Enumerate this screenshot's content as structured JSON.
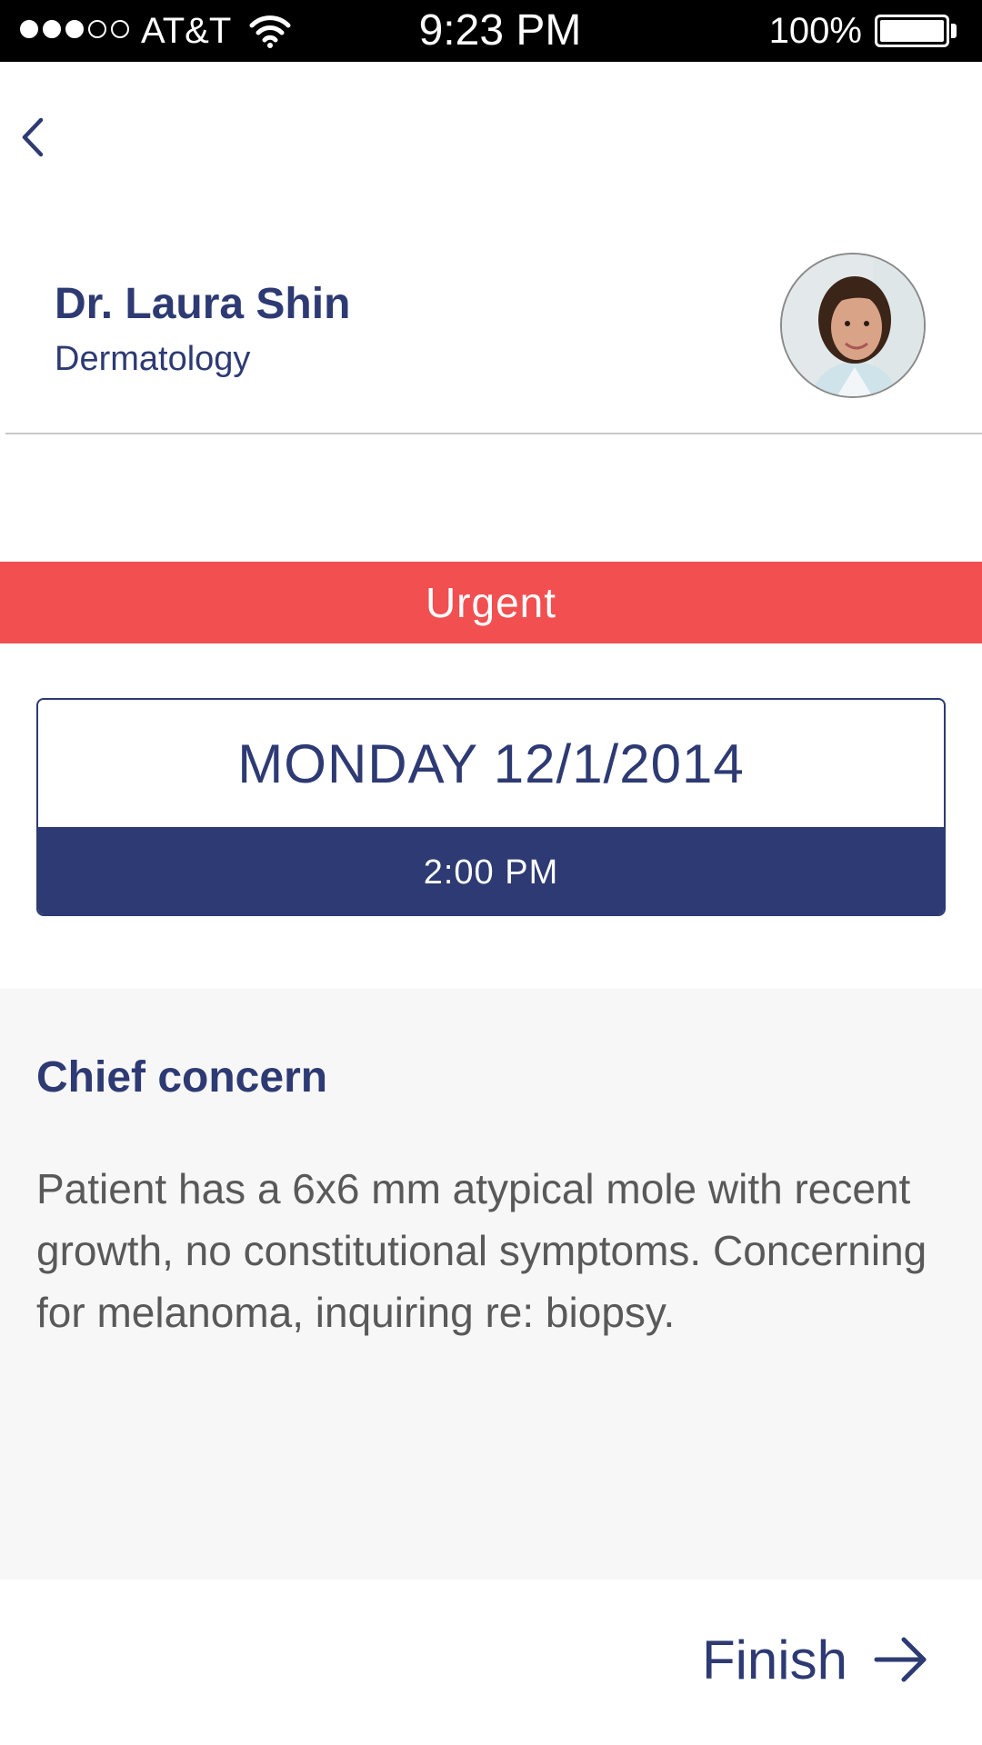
{
  "status_bar": {
    "carrier": "AT&T",
    "time": "9:23 PM",
    "battery_percent": "100%",
    "signal_bars_filled": 3,
    "signal_bars_total": 5
  },
  "navigation": {
    "back_icon": "chevron-left-icon"
  },
  "doctor": {
    "name": "Dr. Laura Shin",
    "specialty": "Dermatology"
  },
  "urgency": {
    "label": "Urgent",
    "color": "#f24f51"
  },
  "appointment": {
    "date": "MONDAY 12/1/2014",
    "time": "2:00 PM"
  },
  "concern": {
    "title": "Chief concern",
    "body": "Patient has a 6x6 mm atypical mole with recent growth, no constitutional symptoms. Concerning for melanoma, inquiring re: biopsy."
  },
  "footer": {
    "finish_label": "Finish",
    "finish_icon": "arrow-right-icon"
  },
  "colors": {
    "primary": "#2d3a73",
    "urgent": "#f24f51",
    "panel_background": "#f7f7f7",
    "body_text": "#595959"
  }
}
